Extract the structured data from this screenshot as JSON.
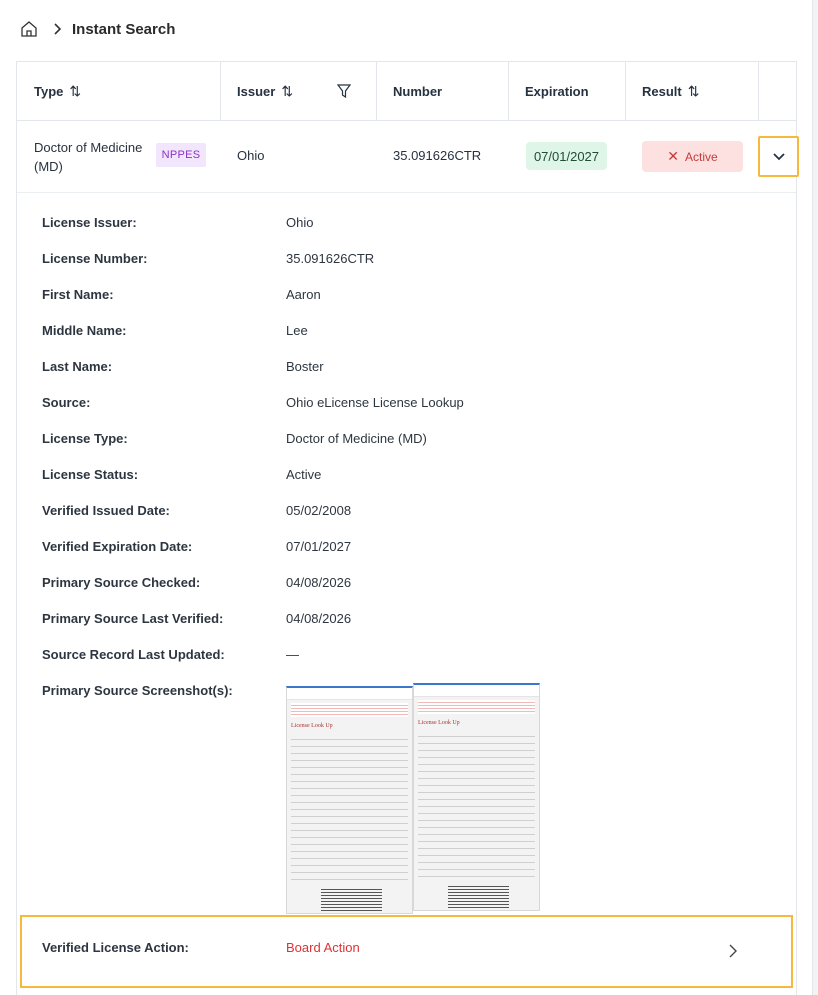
{
  "breadcrumb": {
    "home_icon": "home-icon",
    "separator_icon": "chevron-right-icon",
    "current": "Instant Search"
  },
  "table": {
    "columns": [
      {
        "label": "Type",
        "sortable": true
      },
      {
        "label": "Issuer",
        "sortable": true,
        "filterable": true
      },
      {
        "label": "Number"
      },
      {
        "label": "Expiration"
      },
      {
        "label": "Result",
        "sortable": true
      }
    ],
    "row": {
      "type": "Doctor of Medicine (MD)",
      "badge": "NPPES",
      "issuer": "Ohio",
      "number": "35.091626CTR",
      "expiration": "07/01/2027",
      "result": "Active",
      "result_icon": "x-icon",
      "expand_icon": "chevron-down-icon"
    }
  },
  "details": [
    {
      "label": "License Issuer:",
      "value": "Ohio"
    },
    {
      "label": "License Number:",
      "value": "35.091626CTR"
    },
    {
      "label": "First Name:",
      "value": "Aaron"
    },
    {
      "label": "Middle Name:",
      "value": "Lee"
    },
    {
      "label": "Last Name:",
      "value": "Boster"
    },
    {
      "label": "Source:",
      "value": "Ohio eLicense License Lookup"
    },
    {
      "label": "License Type:",
      "value": "Doctor of Medicine (MD)"
    },
    {
      "label": "License Status:",
      "value": "Active"
    },
    {
      "label": "Verified Issued Date:",
      "value": "05/02/2008"
    },
    {
      "label": "Verified Expiration Date:",
      "value": "07/01/2027"
    },
    {
      "label": "Primary Source Checked:",
      "value": "04/08/2026"
    },
    {
      "label": "Primary Source Last Verified:",
      "value": "04/08/2026"
    },
    {
      "label": "Source Record Last Updated:",
      "value": "—"
    },
    {
      "label": "Primary Source Screenshot(s):",
      "value": ""
    }
  ],
  "screenshots": [
    {
      "title": "License Look Up"
    },
    {
      "title": "License Look Up"
    }
  ],
  "license_action": {
    "label": "Verified License Action:",
    "value": "Board Action",
    "icon": "chevron-right-icon"
  },
  "colors": {
    "highlight": "#f6b93b",
    "badge_purple": "#8a33c9",
    "active_green_bg": "#dff5e7",
    "result_red_bg": "#fde1e1",
    "board_action_red": "#e03131"
  }
}
